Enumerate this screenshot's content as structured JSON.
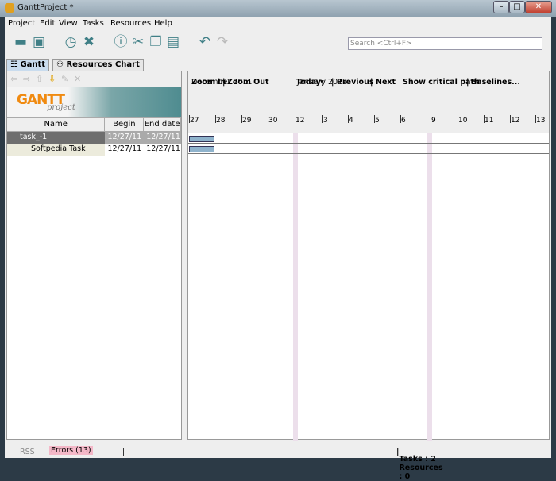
{
  "window": {
    "title": "GanttProject *",
    "controls": [
      "–",
      "□",
      "✕"
    ]
  },
  "menu": [
    "Project",
    "Edit",
    "View",
    "Tasks",
    "Resources",
    "Help"
  ],
  "toolbar": {
    "icons": [
      "open-icon",
      "save-icon",
      "clock-icon",
      "delete-icon",
      "info-icon",
      "cut-icon",
      "copy-icon",
      "paste-icon",
      "undo-icon",
      "redo-icon"
    ],
    "search_placeholder": "Search <Ctrl+F>"
  },
  "tabs": [
    {
      "label": "Gantt",
      "active": true
    },
    {
      "label": "Resources Chart",
      "active": false
    }
  ],
  "logo": {
    "text": "GANTT",
    "sub": "project"
  },
  "table": {
    "columns": [
      "Name",
      "Begin date",
      "End date"
    ],
    "rows": [
      {
        "name": "task_-1",
        "begin": "12/27/11",
        "end": "12/27/11",
        "selected": true
      },
      {
        "name": "Softpedia Task",
        "begin": "12/27/11",
        "end": "12/27/11",
        "selected": false
      }
    ]
  },
  "chart_toolbar": {
    "zoom_in": "Zoom In",
    "zoom_out": "Zoom Out",
    "today": "Today",
    "previous": "Previous",
    "next": "Next",
    "critical": "Show critical path",
    "baselines": "Baselines...",
    "sep": "|"
  },
  "months": [
    "December 2011",
    "January 2012"
  ],
  "days": [
    "27",
    "28",
    "29",
    "30",
    "12",
    "3",
    "4",
    "5",
    "6",
    "9",
    "10",
    "11",
    "12",
    "13"
  ],
  "status": {
    "rss": "RSS",
    "errors": "Errors (13)",
    "summary": "Tasks : 2  Resources : 0"
  }
}
